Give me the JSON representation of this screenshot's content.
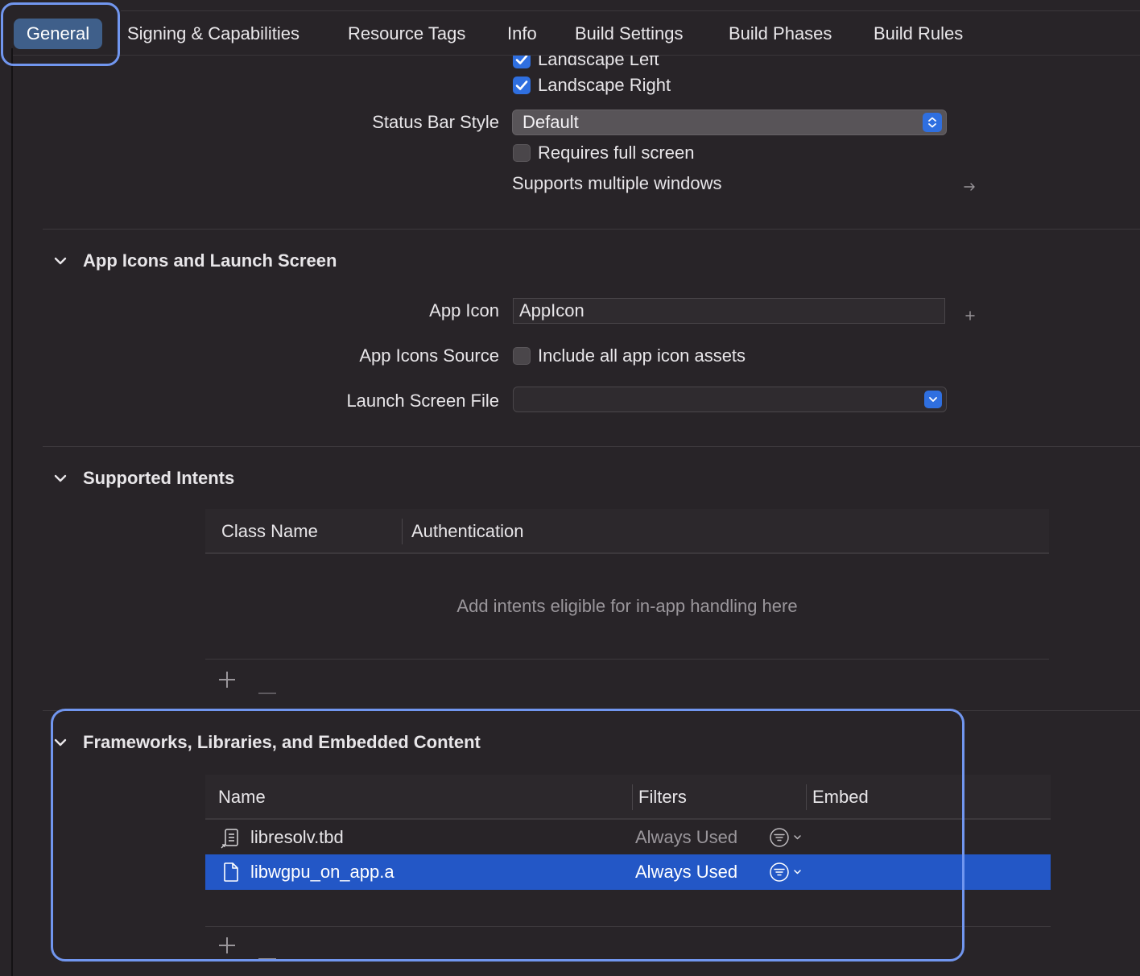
{
  "tabs": [
    {
      "label": "General",
      "selected": true
    },
    {
      "label": "Signing & Capabilities"
    },
    {
      "label": "Resource Tags"
    },
    {
      "label": "Info"
    },
    {
      "label": "Build Settings"
    },
    {
      "label": "Build Phases"
    },
    {
      "label": "Build Rules"
    }
  ],
  "deployment": {
    "landscape_left": {
      "label": "Landscape Left",
      "checked": true
    },
    "landscape_right": {
      "label": "Landscape Right",
      "checked": true
    },
    "status_bar_style": {
      "label": "Status Bar Style",
      "value": "Default"
    },
    "requires_full_screen": {
      "label": "Requires full screen",
      "checked": false
    },
    "supports_multiple_windows": {
      "label": "Supports multiple windows"
    }
  },
  "app_icons_section": {
    "title": "App Icons and Launch Screen",
    "app_icon": {
      "label": "App Icon",
      "value": "AppIcon"
    },
    "app_icons_source": {
      "label": "App Icons Source",
      "checkbox_label": "Include all app icon assets",
      "checked": false
    },
    "launch_screen_file": {
      "label": "Launch Screen File",
      "value": ""
    }
  },
  "intents_section": {
    "title": "Supported Intents",
    "columns": [
      "Class Name",
      "Authentication"
    ],
    "empty_text": "Add intents eligible for in-app handling here"
  },
  "frameworks_section": {
    "title": "Frameworks, Libraries, and Embedded Content",
    "columns": [
      "Name",
      "Filters",
      "Embed"
    ],
    "rows": [
      {
        "name": "libresolv.tbd",
        "filters": "Always Used",
        "selected": false
      },
      {
        "name": "libwgpu_on_app.a",
        "filters": "Always Used",
        "selected": true
      }
    ]
  },
  "colors": {
    "background": "#282428",
    "accent": "#2f6fe0",
    "selection": "#2357c6",
    "highlight_outline": "#7196ef"
  }
}
